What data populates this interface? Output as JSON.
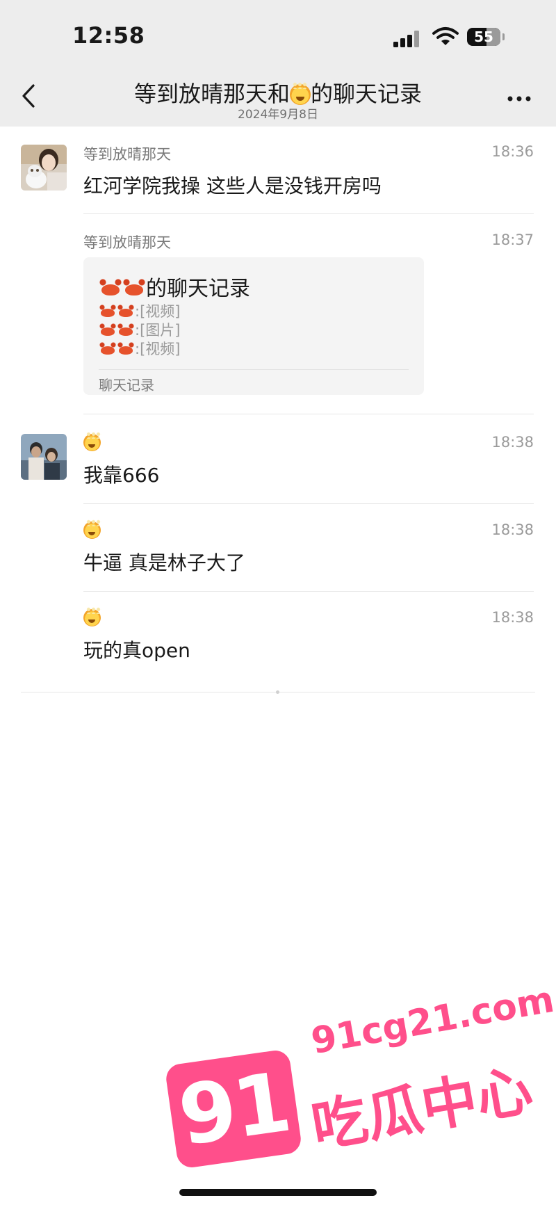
{
  "status_bar": {
    "time": "12:58",
    "battery": "55"
  },
  "nav": {
    "title_prefix": "等到放晴那天和",
    "title_suffix": "的聊天记录",
    "subtitle": "2024年9月8日"
  },
  "messages": [
    {
      "sender": "等到放晴那天",
      "time": "18:36",
      "text": "红河学院我操 这些人是没钱开房吗"
    },
    {
      "sender": "等到放晴那天",
      "time": "18:37",
      "record": {
        "title_suffix": "的聊天记录",
        "lines": [
          ":[视频]",
          ":[图片]",
          ":[视频]"
        ],
        "footer": "聊天记录"
      }
    },
    {
      "time": "18:38",
      "text": "我靠666"
    },
    {
      "time": "18:38",
      "text": "牛逼 真是林子大了"
    },
    {
      "time": "18:38",
      "text": "玩的真open"
    }
  ],
  "watermark": {
    "badge": "91",
    "url": "91cg21.com",
    "name": "吃瓜中心"
  }
}
